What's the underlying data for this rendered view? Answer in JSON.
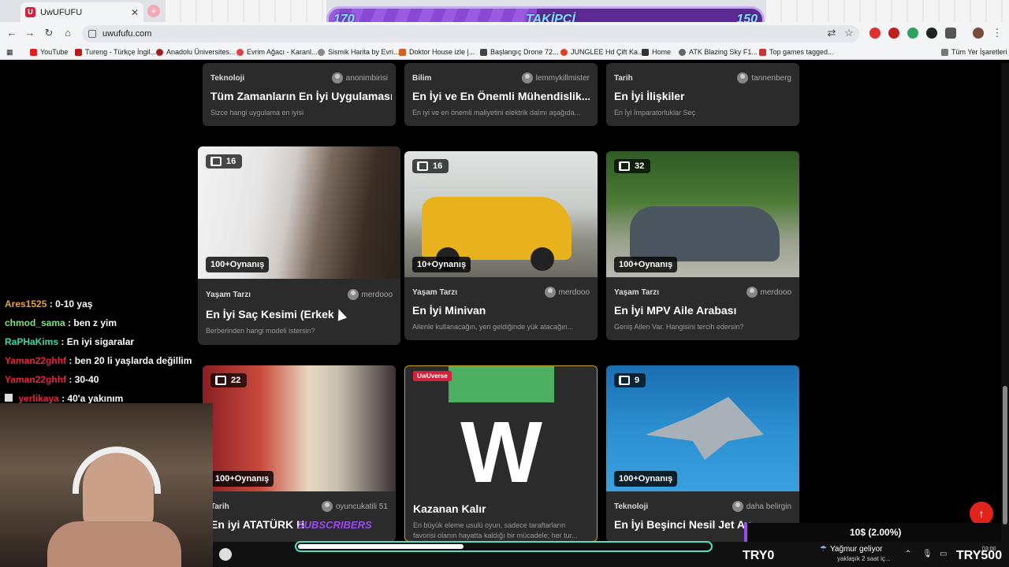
{
  "browser": {
    "tab_title": "UwUFUFU",
    "url": "uwufufu.com",
    "bookmarks": [
      "YouTube",
      "Tureng - Türkçe İngil...",
      "Anadolu Üniversites...",
      "Evrim Ağacı - Karanl...",
      "Sismik Harita by Evri...",
      "Doktor House izle |...",
      "Başlangıç Drone 72...",
      "JUNGLEE Hd Çift Ka...",
      "Home",
      "ATK Blazing Sky F1...",
      "Top games tagged..."
    ],
    "bookmarks_all": "Tüm Yer İşaretleri"
  },
  "follower_goal": {
    "left": "170",
    "label": "TAKİPÇİ",
    "right": "150",
    "progress": 0.48
  },
  "cards_top": [
    {
      "category": "Teknoloji",
      "author": "anonimbirisi",
      "title": "Tüm Zamanların En İyi Uygulaması",
      "desc": "Sizce hangi uygulama en iyisi"
    },
    {
      "category": "Bilim",
      "author": "lemmykillmister",
      "title": "En İyi ve En Önemli Mühendislik...",
      "desc": "En iyi ve en önemli maliyetini elektrik dalını aşağıda..."
    },
    {
      "category": "Tarih",
      "author": "tannenberg",
      "title": "En İyi İlişkiler",
      "desc": "En İyi İmparatorluklar Seç"
    }
  ],
  "cards_mid": [
    {
      "count": "16",
      "plays": "100+Oynanış",
      "category": "Yaşam Tarzı",
      "author": "merdooo",
      "title": "En İyi Saç Kesimi (Erkek",
      "desc": "Berberinden hangi modeli istersin?"
    },
    {
      "count": "16",
      "plays": "10+Oynanış",
      "category": "Yaşam Tarzı",
      "author": "merdooo",
      "title": "En İyi Minivan",
      "desc": "Ailenle kullanacağın, yeri geldiğinde yük atacağın..."
    },
    {
      "count": "32",
      "plays": "100+Oynanış",
      "category": "Yaşam Tarzı",
      "author": "merdooo",
      "title": "En İyi MPV Aile Arabası",
      "desc": "Geniş Ailen Var. Hangisini tercih edersin?"
    }
  ],
  "cards_bot": [
    {
      "count": "22",
      "plays": "100+Oynanış",
      "category": "Tarih",
      "author": "oyuncukatili 51",
      "title": "En iyi ATATÜRK H",
      "overlay": "SUBSCRIBERS"
    },
    {
      "badge": "UwUverse",
      "title": "Kazanan Kalır",
      "desc1": "En büyük eleme usulü oyun, sadece taraftarların",
      "desc2": "favorisi olanın hayatta kaldığı bir mücadele; her tur..."
    },
    {
      "count": "9",
      "plays": "100+Oynanış",
      "category": "Teknoloji",
      "author": "daha belirgin",
      "title": "En İyi Beşinci Nesil Jet Av"
    }
  ],
  "chat": [
    {
      "user": "Ares1525",
      "color": "#e8a33c",
      "msg": ": 0-10 yaş"
    },
    {
      "user": "chmod_sama",
      "color": "#7ee07e",
      "msg": ": ben z yim"
    },
    {
      "user": "RaPHaKims",
      "color": "#3cd6a6",
      "msg": ": En iyi sigaralar"
    },
    {
      "user": "Yaman22ghhf",
      "color": "#e8233c",
      "msg": ": ben 20 li yaşlarda değillim"
    },
    {
      "user": "Yaman22ghhf",
      "color": "#e8233c",
      "msg": ": 30-40"
    },
    {
      "user": "yerlikaya",
      "color": "#e8233c",
      "msg": ": 40'a yakınım"
    }
  ],
  "stream": {
    "donation": "10$ (2.00%)",
    "ticker_left": "TRY0",
    "ticker_right": "TRY500",
    "weather_title": "Yağmur geliyor",
    "weather_sub": "yaklaşık 2 saat iç...",
    "time": "03:00"
  },
  "colors": {
    "accent": "#d4213d",
    "gold": "#c9a227"
  }
}
